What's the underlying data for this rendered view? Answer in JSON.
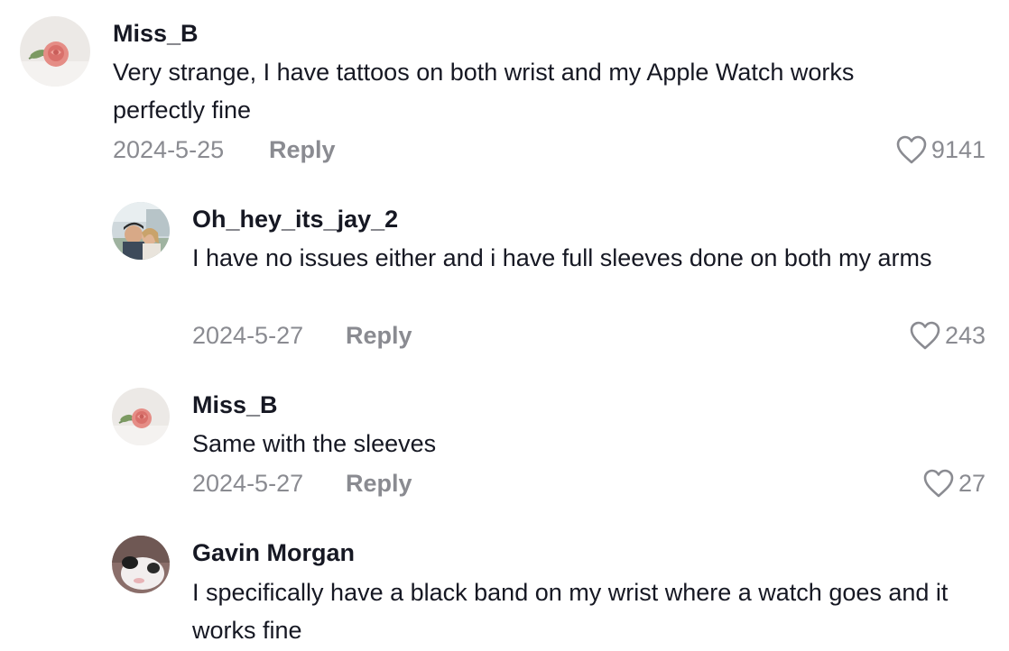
{
  "comments": [
    {
      "username": "Miss_B",
      "text": "Very strange, I have tattoos on both wrist and my Apple Watch works perfectly fine",
      "date": "2024-5-25",
      "reply_label": "Reply",
      "likes": "9141",
      "avatar_icon": "rose-avatar"
    },
    {
      "username": "Oh_hey_its_jay_2",
      "text": "I have no issues either and i have full sleeves done on both my arms",
      "date": "2024-5-27",
      "reply_label": "Reply",
      "likes": "243",
      "avatar_icon": "couple-photo-avatar"
    },
    {
      "username": "Miss_B",
      "text": "Same with the sleeves",
      "date": "2024-5-27",
      "reply_label": "Reply",
      "likes": "27",
      "avatar_icon": "rose-avatar"
    },
    {
      "username": "Gavin Morgan",
      "text": "I specifically have a black band on my wrist where a watch goes and it works fine",
      "date": "",
      "reply_label": "",
      "likes": "",
      "avatar_icon": "cat-avatar"
    }
  ],
  "colors": {
    "text": "#161823",
    "muted": "#8a8b91",
    "background": "#ffffff"
  }
}
